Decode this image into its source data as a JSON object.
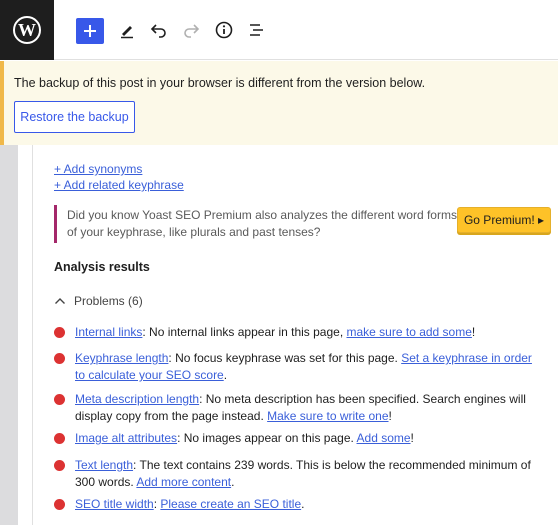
{
  "toolbar": {
    "logo": "wordpress-logo",
    "add_icon": "plus-icon",
    "tools_icon": "pen-icon",
    "undo_icon": "undo-icon",
    "redo_icon": "redo-icon",
    "details_icon": "info-icon",
    "outline_icon": "list-view-icon"
  },
  "notice": {
    "message": "The backup of this post in your browser is different from the version below.",
    "restore_label": "Restore the backup"
  },
  "keyphrase": {
    "add_synonyms": "+ Add synonyms",
    "add_related": "+ Add related keyphrase"
  },
  "premium": {
    "line1": "Did you know Yoast SEO Premium also analyzes the different word forms",
    "line2": "of your keyphrase, like plurals and past tenses?",
    "button_label": "Go Premium! ▸"
  },
  "analysis": {
    "title": "Analysis results",
    "problems_label": "Problems (6)",
    "results": [
      {
        "link": "Internal links",
        "text": ": No internal links appear in this page, ",
        "action": "make sure to add some",
        "tail": "!"
      },
      {
        "link": "Keyphrase length",
        "text": ": No focus keyphrase was set for this page. ",
        "action": "Set a keyphrase in order to calculate your SEO score",
        "tail": "."
      },
      {
        "link": "Meta description length",
        "text": ": No meta description has been specified. Search engines will display copy from the page instead. ",
        "action": "Make sure to write one",
        "tail": "!"
      },
      {
        "link": "Image alt attributes",
        "text": ": No images appear on this page. ",
        "action": "Add some",
        "tail": "!"
      },
      {
        "link": "Text length",
        "text": ": The text contains 239 words. This is below the recommended minimum of 300 words. ",
        "action": "Add more content",
        "tail": "."
      },
      {
        "link": "SEO title width",
        "text": ": ",
        "action": "Please create an SEO title",
        "tail": "."
      }
    ]
  },
  "colors": {
    "accent": "#3858e9",
    "problem": "#dc3232",
    "notice_border": "#f0b849",
    "premium_button": "#fec228",
    "premium_border": "#a4286a"
  }
}
